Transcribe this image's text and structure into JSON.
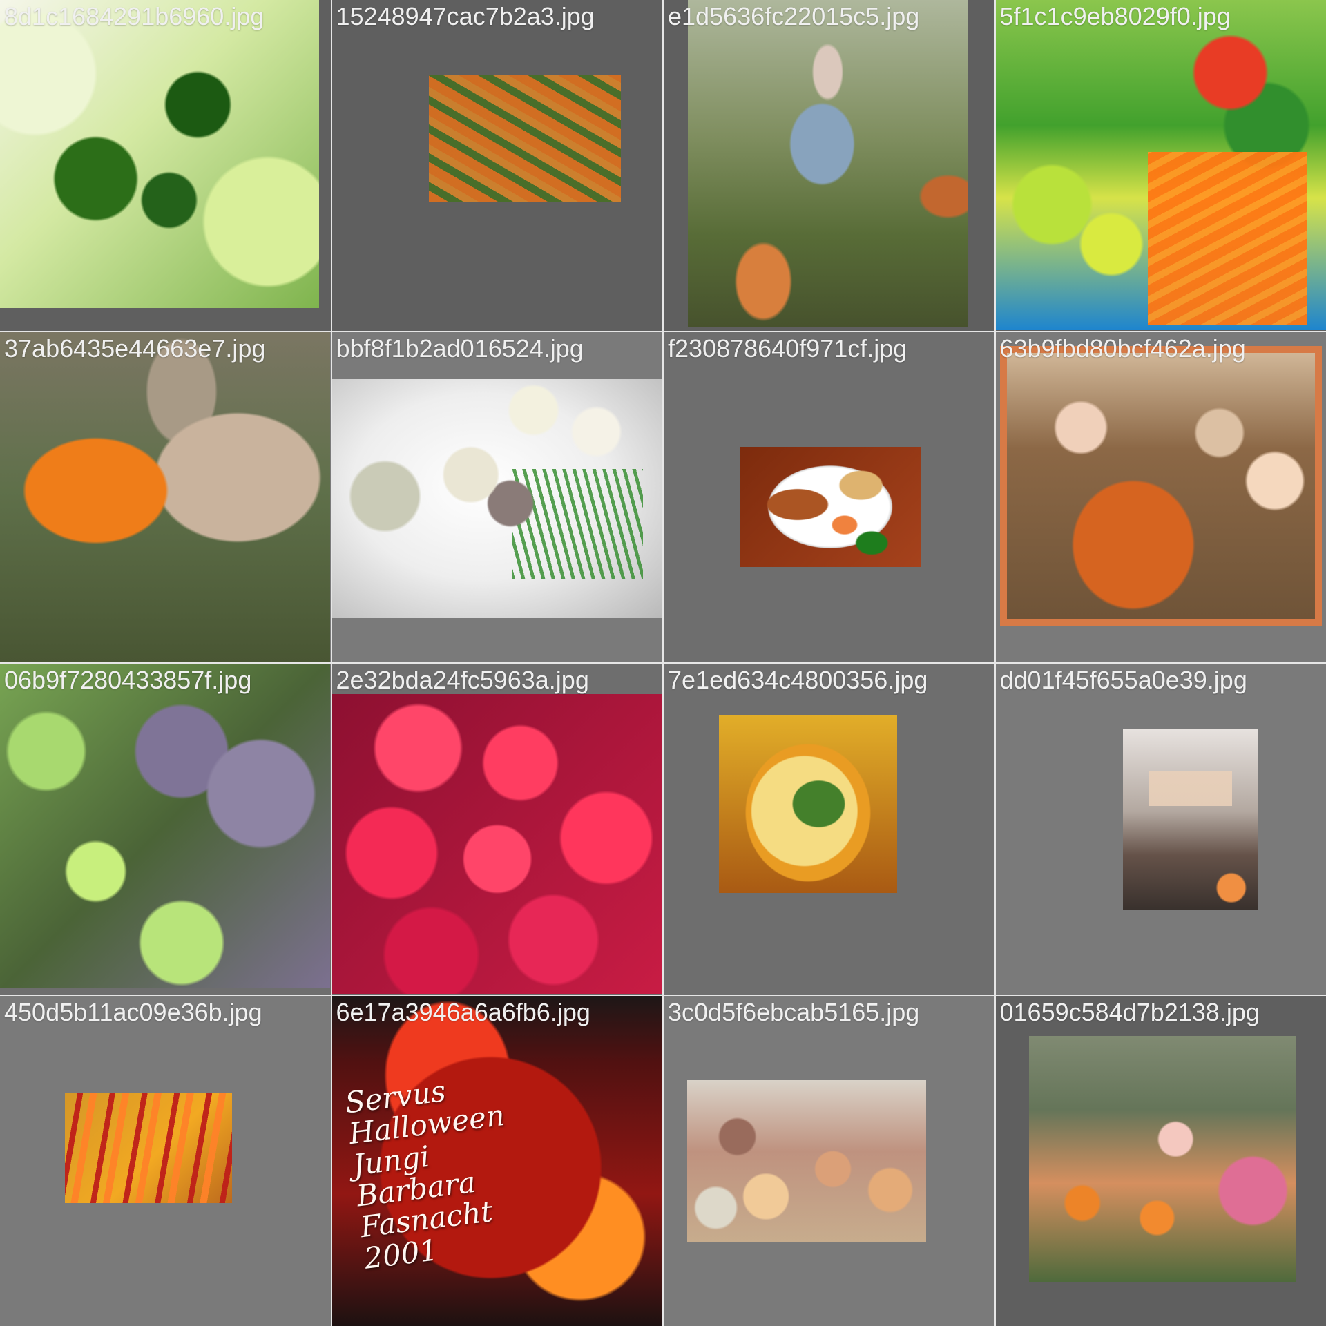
{
  "gallery": {
    "tiles": [
      {
        "filename": "8d1c1684291b6960.jpg",
        "image": "steamed broccoli and cabbage"
      },
      {
        "filename": "15248947cac7b2a3.jpg",
        "image": "green beans and carrots"
      },
      {
        "filename": "e1d5636fc22015c5.jpg",
        "image": "child in pumpkin field"
      },
      {
        "filename": "5f1c1c9eb8029f0.jpg",
        "image": "market vegetables"
      },
      {
        "filename": "37ab6435e44663e7.jpg",
        "image": "goat eating pumpkin"
      },
      {
        "filename": "bbf8f1b2ad016524.jpg",
        "image": "potatoes on plate"
      },
      {
        "filename": "f230878640f971cf.jpg",
        "image": "dinner plate"
      },
      {
        "filename": "63b9fbd80bcf462a.jpg",
        "image": "family with jack-o-lantern"
      },
      {
        "filename": "06b9f7280433857f.jpg",
        "image": "ornamental cabbage"
      },
      {
        "filename": "2e32bda24fc5963a.jpg",
        "image": "red potatoes"
      },
      {
        "filename": "7e1ed634c4800356.jpg",
        "image": "vegetable soup"
      },
      {
        "filename": "dd01f45f655a0e39.jpg",
        "image": "exhibit display"
      },
      {
        "filename": "450d5b11ac09e36b.jpg",
        "image": "carrots"
      },
      {
        "filename": "6e17a3946a6a6fb6.jpg",
        "image": "painted pumpkin",
        "painted_text": "Servus\nHalloween\nJungi\nBarbara\nFasnacht\n2001"
      },
      {
        "filename": "3c0d5f6ebcab5165.jpg",
        "image": "pile of pumpkins"
      },
      {
        "filename": "01659c584d7b2138.jpg",
        "image": "children painting pumpkins"
      }
    ]
  }
}
